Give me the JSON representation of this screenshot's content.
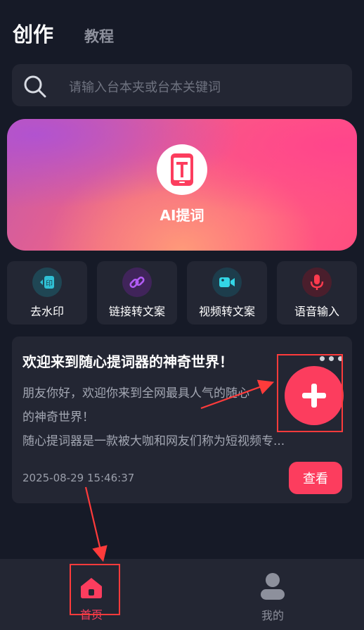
{
  "header": {
    "tab_active": "创作",
    "tab_inactive": "教程"
  },
  "search": {
    "placeholder": "请输入台本夹或台本关键词",
    "icon": "search-icon"
  },
  "banner": {
    "title": "AI提词",
    "icon": "teleprompter-logo-icon"
  },
  "tools": [
    {
      "label": "去水印",
      "icon": "watermark-remove-icon",
      "color": "#2aa3b8"
    },
    {
      "label": "链接转文案",
      "icon": "link-icon",
      "color": "#9b3fe0"
    },
    {
      "label": "视频转文案",
      "icon": "video-camera-icon",
      "color": "#2ad0e0"
    },
    {
      "label": "语音输入",
      "icon": "microphone-icon",
      "color": "#ff3b4e"
    }
  ],
  "card": {
    "title": "欢迎来到随心提词器的神奇世界！",
    "body_lines": [
      "朋友你好，欢迎你来到全网最具人气的随心",
      "的神奇世界！",
      "随心提词器是一款被大咖和网友们称为短视频专..."
    ],
    "timestamp": "2025-08-29 15:46:37",
    "view_label": "查看"
  },
  "fab": {
    "icon": "plus-icon"
  },
  "nav": {
    "home_label": "首页",
    "me_label": "我的"
  },
  "colors": {
    "accent": "#fc3d5e",
    "background": "#161a27",
    "surface": "#232633",
    "annotation": "#ff3b3b"
  }
}
